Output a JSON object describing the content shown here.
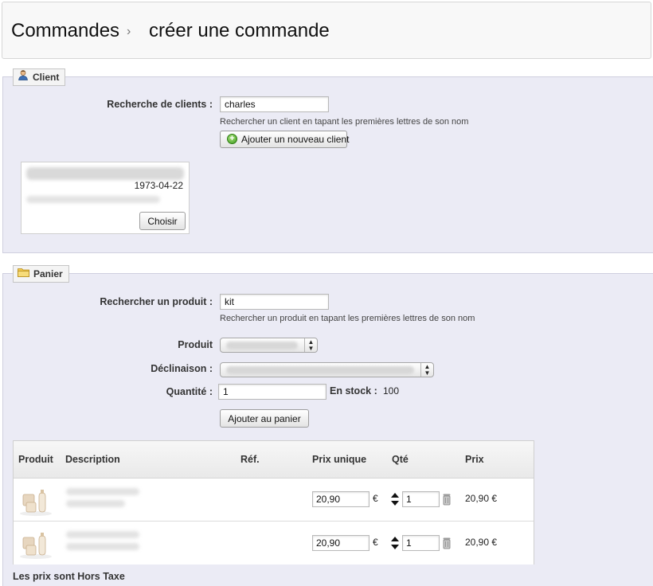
{
  "breadcrumb": {
    "parent": "Commandes",
    "separator": "›",
    "current": "créer une commande"
  },
  "client": {
    "legend": "Client",
    "search_label": "Recherche de clients :",
    "search_value": "charles",
    "search_hint": "Rechercher un client en tapant les premières lettres de son nom",
    "add_button": "Ajouter un nouveau client",
    "result": {
      "birthdate": "1973-04-22",
      "choose_button": "Choisir"
    }
  },
  "cart": {
    "legend": "Panier",
    "product_search_label": "Rechercher un produit :",
    "product_search_value": "kit",
    "product_search_hint": "Rechercher un produit en tapant les premières lettres de son nom",
    "product_label": "Produit",
    "declinaison_label": "Déclinaison :",
    "quantity_label": "Quantité :",
    "quantity_value": "1",
    "stock_label": "En stock :",
    "stock_value": "100",
    "add_button": "Ajouter au panier",
    "table": {
      "headers": {
        "produit": "Produit",
        "description": "Description",
        "ref": "Réf.",
        "prix_unique": "Prix unique",
        "qte": "Qté",
        "prix": "Prix"
      },
      "rows": [
        {
          "unit_price": "20,90",
          "currency": "€",
          "qty": "1",
          "total": "20,90 €"
        },
        {
          "unit_price": "20,90",
          "currency": "€",
          "qty": "1",
          "total": "20,90 €"
        }
      ]
    },
    "tax_note": "Les prix sont Hors Taxe"
  }
}
